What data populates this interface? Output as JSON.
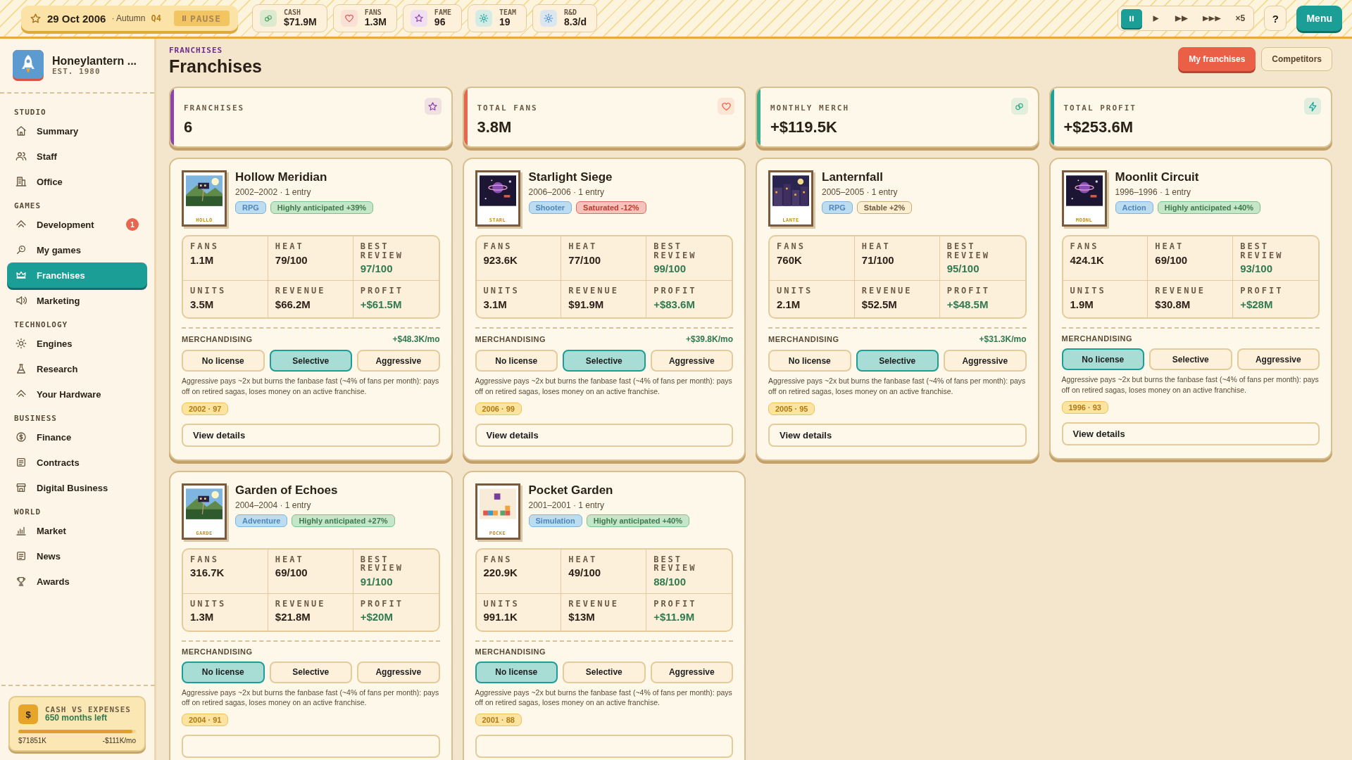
{
  "topbar": {
    "date": "29 Oct 2006",
    "season": "· Autumn",
    "quarter": "Q4",
    "pause_button": "PAUSE",
    "stats": [
      {
        "label": "CASH",
        "value": "$71.9M"
      },
      {
        "label": "FANS",
        "value": "1.3M"
      },
      {
        "label": "FAME",
        "value": "96"
      },
      {
        "label": "TEAM",
        "value": "19"
      },
      {
        "label": "R&D",
        "value": "8.3/d"
      }
    ],
    "speed_controls": [
      {
        "kind": "pause",
        "selected": true
      },
      {
        "kind": "play",
        "selected": false
      },
      {
        "kind": "fast",
        "selected": false
      },
      {
        "kind": "fastest",
        "selected": false
      },
      {
        "kind": "text",
        "label": "×5",
        "selected": false
      }
    ],
    "help_button": "?",
    "menu_button": "Menu"
  },
  "sidebar": {
    "studio_name": "Honeylantern ...",
    "founded": "EST. 1980",
    "sections": [
      {
        "title": "STUDIO",
        "items": [
          {
            "label": "Summary",
            "selected": false
          },
          {
            "label": "Staff",
            "selected": false
          },
          {
            "label": "Office",
            "selected": false
          }
        ]
      },
      {
        "title": "GAMES",
        "items": [
          {
            "label": "Development",
            "selected": false,
            "badge": "1"
          },
          {
            "label": "My games",
            "selected": false
          },
          {
            "label": "Franchises",
            "selected": true
          },
          {
            "label": "Marketing",
            "selected": false
          }
        ]
      },
      {
        "title": "TECHNOLOGY",
        "items": [
          {
            "label": "Engines",
            "selected": false
          },
          {
            "label": "Research",
            "selected": false
          },
          {
            "label": "Your Hardware",
            "selected": false
          }
        ]
      },
      {
        "title": "BUSINESS",
        "items": [
          {
            "label": "Finance",
            "selected": false
          },
          {
            "label": "Contracts",
            "selected": false
          },
          {
            "label": "Digital Business",
            "selected": false
          }
        ]
      },
      {
        "title": "WORLD",
        "items": [
          {
            "label": "Market",
            "selected": false
          },
          {
            "label": "News",
            "selected": false
          },
          {
            "label": "Awards",
            "selected": false
          }
        ]
      }
    ],
    "cash_card": {
      "icon_label": "$",
      "title": "CASH VS EXPENSES",
      "subtitle": "650 months left",
      "level": 0.97,
      "cash": "$71851K",
      "burn": "-$111K/mo"
    }
  },
  "main": {
    "eyebrow": "FRANCHISES",
    "title": "Franchises",
    "view_tabs": [
      {
        "label": "My franchises",
        "selected": true
      },
      {
        "label": "Competitors",
        "selected": false
      }
    ],
    "summary": [
      {
        "label": "FRANCHISES",
        "value": "6",
        "color": "#8e44ad"
      },
      {
        "label": "TOTAL FANS",
        "value": "3.8M",
        "color": "#e8664f"
      },
      {
        "label": "MONTHLY MERCH",
        "value": "+$119.5K",
        "color": "#3aae8c"
      },
      {
        "label": "TOTAL PROFIT",
        "value": "+$253.6M",
        "color": "#1aa39b"
      }
    ],
    "franchises": [
      {
        "name": "Hollow Meridian",
        "years": "2002–2002 · 1 entry",
        "cover_label": "HOLLO",
        "genre": "RPG",
        "status": {
          "label": "Highly anticipated +39%",
          "kind": "hot"
        },
        "stats": [
          {
            "label": "FANS",
            "value": "1.1M",
            "positive": false
          },
          {
            "label": "HEAT",
            "value": "79/100",
            "positive": false
          },
          {
            "label": "BEST REVIEW",
            "value": "97/100",
            "positive": true
          },
          {
            "label": "UNITS",
            "value": "3.5M",
            "positive": false
          },
          {
            "label": "REVENUE",
            "value": "$66.2M",
            "positive": false
          },
          {
            "label": "PROFIT",
            "value": "+$61.5M",
            "positive": true
          }
        ],
        "merch": {
          "label": "MERCHANDISING",
          "income": "+$48.3K/mo",
          "options": [
            {
              "label": "No license",
              "selected": false
            },
            {
              "label": "Selective",
              "selected": true
            },
            {
              "label": "Aggressive",
              "selected": false
            }
          ],
          "note": "Aggressive pays ~2x but burns the fanbase fast (~4% of fans per month): pays off on retired sagas, loses money on an active franchise."
        },
        "tag": "2002 · 97",
        "view_button": "View details"
      },
      {
        "name": "Starlight Siege",
        "years": "2006–2006 · 1 entry",
        "cover_label": "STARL",
        "genre": "Shooter",
        "status": {
          "label": "Saturated -12%",
          "kind": "saturated"
        },
        "stats": [
          {
            "label": "FANS",
            "value": "923.6K",
            "positive": false
          },
          {
            "label": "HEAT",
            "value": "77/100",
            "positive": false
          },
          {
            "label": "BEST REVIEW",
            "value": "99/100",
            "positive": true
          },
          {
            "label": "UNITS",
            "value": "3.1M",
            "positive": false
          },
          {
            "label": "REVENUE",
            "value": "$91.9M",
            "positive": false
          },
          {
            "label": "PROFIT",
            "value": "+$83.6M",
            "positive": true
          }
        ],
        "merch": {
          "label": "MERCHANDISING",
          "income": "+$39.8K/mo",
          "options": [
            {
              "label": "No license",
              "selected": false
            },
            {
              "label": "Selective",
              "selected": true
            },
            {
              "label": "Aggressive",
              "selected": false
            }
          ],
          "note": "Aggressive pays ~2x but burns the fanbase fast (~4% of fans per month): pays off on retired sagas, loses money on an active franchise."
        },
        "tag": "2006 · 99",
        "view_button": "View details"
      },
      {
        "name": "Lanternfall",
        "years": "2005–2005 · 1 entry",
        "cover_label": "LANTE",
        "genre": "RPG",
        "status": {
          "label": "Stable +2%",
          "kind": "stable"
        },
        "stats": [
          {
            "label": "FANS",
            "value": "760K",
            "positive": false
          },
          {
            "label": "HEAT",
            "value": "71/100",
            "positive": false
          },
          {
            "label": "BEST REVIEW",
            "value": "95/100",
            "positive": true
          },
          {
            "label": "UNITS",
            "value": "2.1M",
            "positive": false
          },
          {
            "label": "REVENUE",
            "value": "$52.5M",
            "positive": false
          },
          {
            "label": "PROFIT",
            "value": "+$48.5M",
            "positive": true
          }
        ],
        "merch": {
          "label": "MERCHANDISING",
          "income": "+$31.3K/mo",
          "options": [
            {
              "label": "No license",
              "selected": false
            },
            {
              "label": "Selective",
              "selected": true
            },
            {
              "label": "Aggressive",
              "selected": false
            }
          ],
          "note": "Aggressive pays ~2x but burns the fanbase fast (~4% of fans per month): pays off on retired sagas, loses money on an active franchise."
        },
        "tag": "2005 · 95",
        "view_button": "View details"
      },
      {
        "name": "Moonlit Circuit",
        "years": "1996–1996 · 1 entry",
        "cover_label": "MOONL",
        "genre": "Action",
        "status": {
          "label": "Highly anticipated +40%",
          "kind": "hot"
        },
        "stats": [
          {
            "label": "FANS",
            "value": "424.1K",
            "positive": false
          },
          {
            "label": "HEAT",
            "value": "69/100",
            "positive": false
          },
          {
            "label": "BEST REVIEW",
            "value": "93/100",
            "positive": true
          },
          {
            "label": "UNITS",
            "value": "1.9M",
            "positive": false
          },
          {
            "label": "REVENUE",
            "value": "$30.8M",
            "positive": false
          },
          {
            "label": "PROFIT",
            "value": "+$28M",
            "positive": true
          }
        ],
        "merch": {
          "label": "MERCHANDISING",
          "options": [
            {
              "label": "No license",
              "selected": true
            },
            {
              "label": "Selective",
              "selected": false
            },
            {
              "label": "Aggressive",
              "selected": false
            }
          ],
          "note": "Aggressive pays ~2x but burns the fanbase fast (~4% of fans per month): pays off on retired sagas, loses money on an active franchise."
        },
        "tag": "1996 · 93",
        "view_button": "View details"
      },
      {
        "name": "Garden of Echoes",
        "years": "2004–2004 · 1 entry",
        "cover_label": "GARDE",
        "genre": "Adventure",
        "status": {
          "label": "Highly anticipated +27%",
          "kind": "hot"
        },
        "stats": [
          {
            "label": "FANS",
            "value": "316.7K",
            "positive": false
          },
          {
            "label": "HEAT",
            "value": "69/100",
            "positive": false
          },
          {
            "label": "BEST REVIEW",
            "value": "91/100",
            "positive": true
          },
          {
            "label": "UNITS",
            "value": "1.3M",
            "positive": false
          },
          {
            "label": "REVENUE",
            "value": "$21.8M",
            "positive": false
          },
          {
            "label": "PROFIT",
            "value": "+$20M",
            "positive": true
          }
        ],
        "merch": {
          "label": "MERCHANDISING",
          "options": [
            {
              "label": "No license",
              "selected": true
            },
            {
              "label": "Selective",
              "selected": false
            },
            {
              "label": "Aggressive",
              "selected": false
            }
          ],
          "note": "Aggressive pays ~2x but burns the fanbase fast (~4% of fans per month): pays off on retired sagas, loses money on an active franchise."
        },
        "tag": "2004 · 91"
      },
      {
        "name": "Pocket Garden",
        "years": "2001–2001 · 1 entry",
        "cover_label": "POCKE",
        "genre": "Simulation",
        "status": {
          "label": "Highly anticipated +40%",
          "kind": "hot"
        },
        "stats": [
          {
            "label": "FANS",
            "value": "220.9K",
            "positive": false
          },
          {
            "label": "HEAT",
            "value": "49/100",
            "positive": false
          },
          {
            "label": "BEST REVIEW",
            "value": "88/100",
            "positive": true
          },
          {
            "label": "UNITS",
            "value": "991.1K",
            "positive": false
          },
          {
            "label": "REVENUE",
            "value": "$13M",
            "positive": false
          },
          {
            "label": "PROFIT",
            "value": "+$11.9M",
            "positive": true
          }
        ],
        "merch": {
          "label": "MERCHANDISING",
          "options": [
            {
              "label": "No license",
              "selected": true
            },
            {
              "label": "Selective",
              "selected": false
            },
            {
              "label": "Aggressive",
              "selected": false
            }
          ],
          "note": "Aggressive pays ~2x but burns the fanbase fast (~4% of fans per month): pays off on retired sagas, loses money on an active franchise."
        },
        "tag": "2001 · 88"
      }
    ]
  }
}
